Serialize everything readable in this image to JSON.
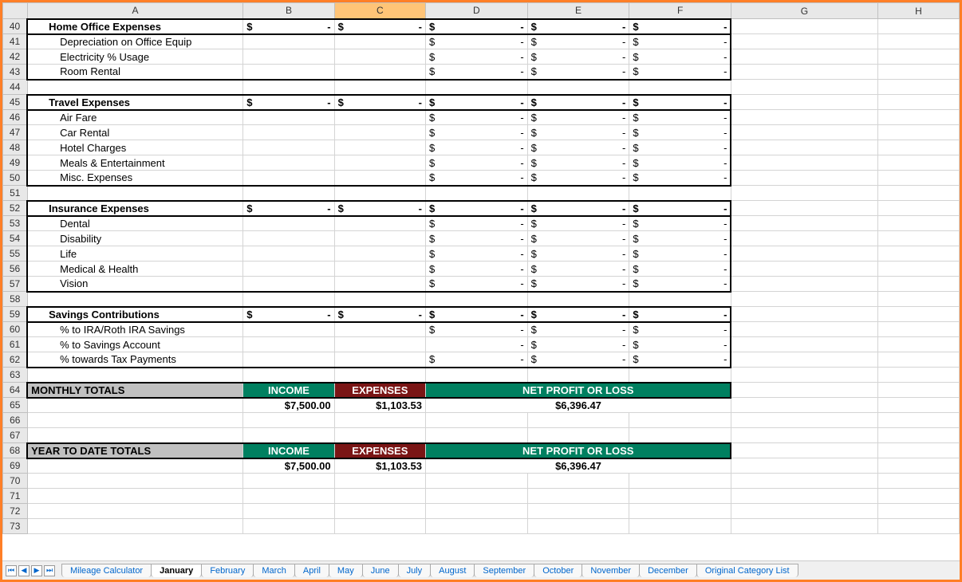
{
  "columns": [
    "A",
    "B",
    "C",
    "D",
    "E",
    "F",
    "G",
    "H"
  ],
  "sections": [
    {
      "row": 40,
      "title": "Home Office Expenses",
      "totals": [
        "$  -",
        "$  -",
        "$  -",
        "$  -",
        "$  -"
      ],
      "items": [
        {
          "row": 41,
          "label": "Depreciation on Office Equip",
          "d": "$  -",
          "e": "$  -",
          "f": "$  -"
        },
        {
          "row": 42,
          "label": "Electricity % Usage",
          "d": "$  -",
          "e": "$  -",
          "f": "$  -"
        },
        {
          "row": 43,
          "label": "Room Rental",
          "d": "$  -",
          "e": "$  -",
          "f": "$  -"
        }
      ],
      "blank_after": 44
    },
    {
      "row": 45,
      "title": "Travel Expenses",
      "totals": [
        "$  -",
        "$  -",
        "$  -",
        "$  -",
        "$  -"
      ],
      "items": [
        {
          "row": 46,
          "label": "Air Fare",
          "d": "$  -",
          "e": "$  -",
          "f": "$  -"
        },
        {
          "row": 47,
          "label": "Car Rental",
          "d": "$  -",
          "e": "$  -",
          "f": "$  -"
        },
        {
          "row": 48,
          "label": "Hotel Charges",
          "d": "$  -",
          "e": "$  -",
          "f": "$  -"
        },
        {
          "row": 49,
          "label": "Meals & Entertainment",
          "d": "$  -",
          "e": "$  -",
          "f": "$  -"
        },
        {
          "row": 50,
          "label": "Misc. Expenses",
          "d": "$  -",
          "e": "$  -",
          "f": "$  -"
        }
      ],
      "blank_after": 51
    },
    {
      "row": 52,
      "title": "Insurance Expenses",
      "totals": [
        "$  -",
        "$  -",
        "$  -",
        "$  -",
        "$  -"
      ],
      "items": [
        {
          "row": 53,
          "label": "Dental",
          "d": "$  -",
          "e": "$  -",
          "f": "$  -"
        },
        {
          "row": 54,
          "label": "Disability",
          "d": "$  -",
          "e": "$  -",
          "f": "$  -"
        },
        {
          "row": 55,
          "label": "Life",
          "d": "$  -",
          "e": "$  -",
          "f": "$  -"
        },
        {
          "row": 56,
          "label": "Medical & Health",
          "d": "$  -",
          "e": "$  -",
          "f": "$  -"
        },
        {
          "row": 57,
          "label": "Vision",
          "d": "$  -",
          "e": "$  -",
          "f": "$  -"
        }
      ],
      "blank_after": 58
    },
    {
      "row": 59,
      "title": "Savings Contributions",
      "totals": [
        "$  -",
        "$  -",
        "$  -",
        "$  -",
        "$  -"
      ],
      "items": [
        {
          "row": 60,
          "label": "% to IRA/Roth IRA Savings",
          "d": "$  -",
          "e": "$  -",
          "f": "$  -"
        },
        {
          "row": 61,
          "label": "% to Savings Account",
          "d": "-",
          "e": "$  -",
          "f": "$  -"
        },
        {
          "row": 62,
          "label": "% towards Tax Payments",
          "d": "$  -",
          "e": "$  -",
          "f": "$  -"
        }
      ],
      "blank_after": 63
    }
  ],
  "summary": [
    {
      "headerRow": 64,
      "title": "MONTHLY TOTALS",
      "income_label": "INCOME",
      "expenses_label": "EXPENSES",
      "net_label": "NET PROFIT OR LOSS",
      "valueRow": 65,
      "income": "$7,500.00",
      "expenses": "$1,103.53",
      "net": "$6,396.47"
    },
    {
      "headerRow": 68,
      "title": "YEAR TO DATE TOTALS",
      "income_label": "INCOME",
      "expenses_label": "EXPENSES",
      "net_label": "NET PROFIT OR LOSS",
      "valueRow": 69,
      "income": "$7,500.00",
      "expenses": "$1,103.53",
      "net": "$6,396.47"
    }
  ],
  "blank_rows": [
    66,
    67,
    70,
    71,
    72,
    73
  ],
  "tabs": [
    "Mileage Calculator",
    "January",
    "February",
    "March",
    "April",
    "May",
    "June",
    "July",
    "August",
    "September",
    "October",
    "November",
    "December",
    "Original Category List"
  ],
  "active_tab": "January",
  "selected_column": "C"
}
